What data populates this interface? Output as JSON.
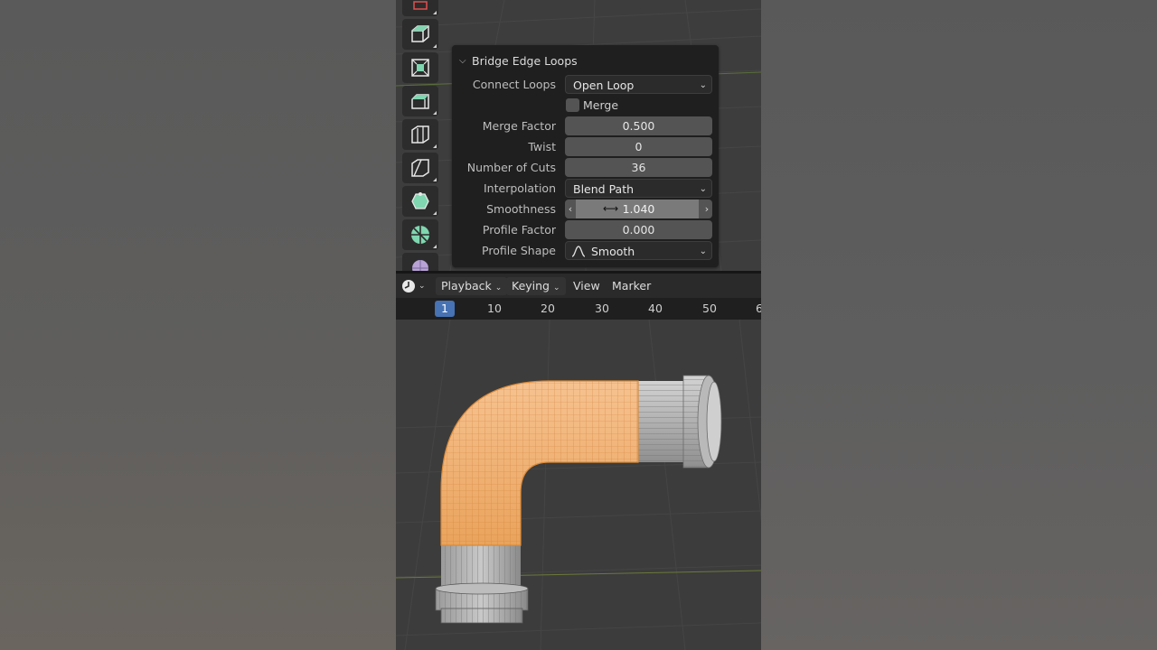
{
  "operator_panel": {
    "title": "Bridge Edge Loops",
    "connect_loops": {
      "label": "Connect Loops",
      "value": "Open Loop"
    },
    "merge": {
      "label": "Merge",
      "checked": false
    },
    "merge_factor": {
      "label": "Merge Factor",
      "value": "0.500"
    },
    "twist": {
      "label": "Twist",
      "value": "0"
    },
    "number_of_cuts": {
      "label": "Number of Cuts",
      "value": "36"
    },
    "interpolation": {
      "label": "Interpolation",
      "value": "Blend Path"
    },
    "smoothness": {
      "label": "Smoothness",
      "value": "1.040"
    },
    "profile_factor": {
      "label": "Profile Factor",
      "value": "0.000"
    },
    "profile_shape": {
      "label": "Profile Shape",
      "value": "Smooth"
    }
  },
  "toolbar": {
    "tools": [
      "extrude-region-icon",
      "inset-faces-icon",
      "bevel-icon",
      "loop-cut-icon",
      "knife-icon",
      "poly-build-icon",
      "spin-icon",
      "smooth-vertices-icon"
    ]
  },
  "timeline": {
    "menus": {
      "playback": "Playback",
      "keying": "Keying",
      "view": "View",
      "marker": "Marker"
    },
    "current_frame": "1",
    "frames": [
      "10",
      "20",
      "30",
      "40",
      "50",
      "6"
    ]
  },
  "colors": {
    "accent_blue": "#4772b3",
    "selection_orange": "#f0a55f",
    "tool_green": "#7fd6b0"
  }
}
